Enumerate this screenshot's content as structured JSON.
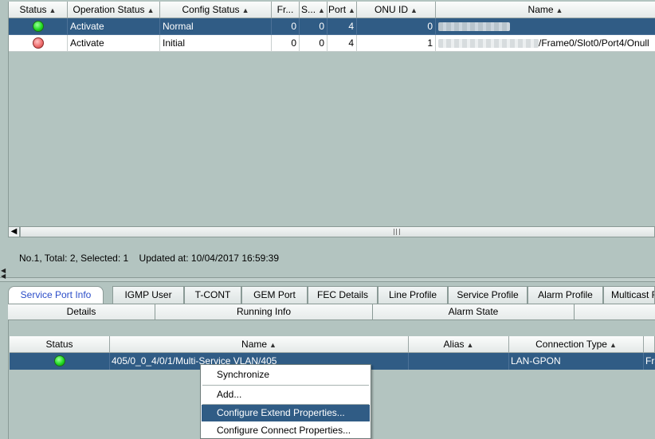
{
  "onu_table": {
    "columns": [
      "Status",
      "Operation Status",
      "Config Status",
      "Fr...",
      "S...",
      "Port",
      "ONU ID",
      "Name"
    ],
    "rows": [
      {
        "status_color": "#22dd22",
        "operation_status": "Activate",
        "config_status": "Normal",
        "frame": "0",
        "slot": "0",
        "port": "4",
        "onu_id": "0",
        "name_visible": ""
      },
      {
        "status_color": "#f07070",
        "operation_status": "Activate",
        "config_status": "Initial",
        "frame": "0",
        "slot": "0",
        "port": "4",
        "onu_id": "1",
        "name_visible": "/Frame0/Slot0/Port4/Onull"
      }
    ]
  },
  "status_bar": {
    "summary": "No.1, Total: 2, Selected: 1",
    "updated": "Updated at: 10/04/2017 16:59:39"
  },
  "tabs": [
    {
      "label": "Service Port Info",
      "active": true
    },
    {
      "label": "IGMP User",
      "active": false
    },
    {
      "label": "T-CONT",
      "active": false
    },
    {
      "label": "GEM Port",
      "active": false
    },
    {
      "label": "FEC Details",
      "active": false
    },
    {
      "label": "Line Profile",
      "active": false
    },
    {
      "label": "Service Profile",
      "active": false
    },
    {
      "label": "Alarm Profile",
      "active": false
    },
    {
      "label": "Multicast F",
      "active": false
    }
  ],
  "subtabs": [
    "Details",
    "Running Info",
    "Alarm State"
  ],
  "service_port_table": {
    "columns": [
      "Status",
      "Name",
      "Alias",
      "Connection Type"
    ],
    "rows": [
      {
        "status_color": "#22dd22",
        "name": "405/0_0_4/0/1/Multi-Service VLAN/405",
        "alias": "",
        "connection_type": "LAN-GPON",
        "extra": "Fra"
      }
    ]
  },
  "context_menu": {
    "items": [
      {
        "label": "Synchronize",
        "hover": false
      },
      {
        "label": "Add...",
        "hover": false
      },
      {
        "label": "Configure Extend Properties...",
        "hover": true
      },
      {
        "label": "Configure Connect Properties...",
        "hover": false
      }
    ]
  },
  "colors": {
    "selection": "#305c85",
    "background": "#b3c4c0",
    "active_tab_text": "#2b4dc8"
  }
}
